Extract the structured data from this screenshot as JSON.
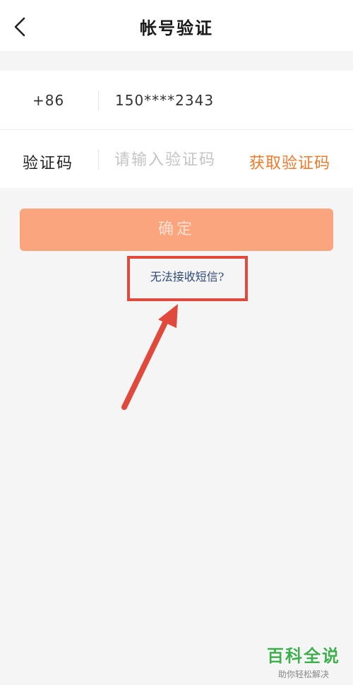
{
  "header": {
    "title": "帐号验证",
    "back_icon": "chevron-left-icon"
  },
  "form": {
    "country_code": "+86",
    "phone_number": "150****2343",
    "code_label": "验证码",
    "code_placeholder": "请输入验证码",
    "code_value": "",
    "get_code_label": "获取验证码"
  },
  "actions": {
    "confirm_label": "确定",
    "sms_help_label": "无法接收短信?"
  },
  "watermark": {
    "brand": "百科全说",
    "tagline": "助你轻松解决"
  },
  "colors": {
    "accent": "#f07a2a",
    "button": "#fba57e",
    "highlight": "#e04a3c",
    "link": "#2f4a7a",
    "background": "#f5f5f5",
    "watermark": "#3eaf4d"
  }
}
